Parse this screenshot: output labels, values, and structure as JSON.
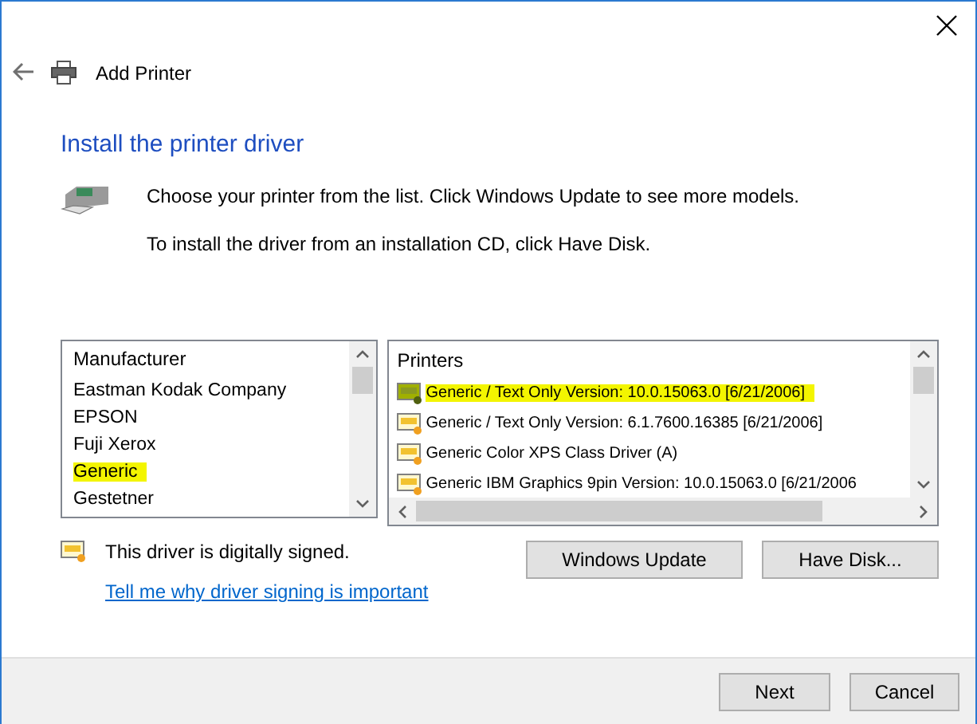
{
  "window": {
    "title": "Add Printer"
  },
  "heading": "Install the printer driver",
  "instructions": [
    "Choose your printer from the list. Click Windows Update to see more models.",
    "To install the driver from an installation CD, click Have Disk."
  ],
  "manufacturers": {
    "header": "Manufacturer",
    "items": [
      {
        "label": "Eastman Kodak Company",
        "selected": false
      },
      {
        "label": "EPSON",
        "selected": false
      },
      {
        "label": "Fuji Xerox",
        "selected": false
      },
      {
        "label": "Generic",
        "selected": true
      },
      {
        "label": "Gestetner",
        "selected": false
      }
    ]
  },
  "printers": {
    "header": "Printers",
    "items": [
      {
        "label": "Generic / Text Only Version: 10.0.15063.0 [6/21/2006]",
        "selected": true
      },
      {
        "label": "Generic / Text Only Version: 6.1.7600.16385 [6/21/2006]",
        "selected": false
      },
      {
        "label": "Generic Color XPS Class Driver (A)",
        "selected": false
      },
      {
        "label": "Generic IBM Graphics 9pin Version: 10.0.15063.0 [6/21/2006",
        "selected": false
      }
    ]
  },
  "signature": {
    "text": "This driver is digitally signed.",
    "link": "Tell me why driver signing is important"
  },
  "buttons": [
    "Windows Update",
    "Have Disk..."
  ],
  "footer_buttons": [
    "Next",
    "Cancel"
  ]
}
